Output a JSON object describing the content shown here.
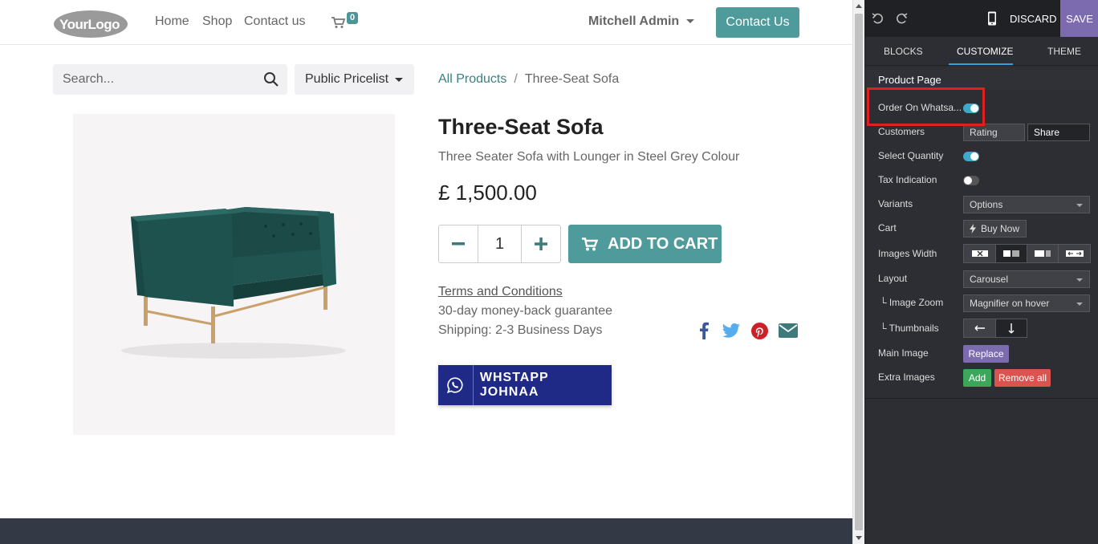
{
  "header": {
    "logo_text": "YourLogo",
    "nav": [
      "Home",
      "Shop",
      "Contact us"
    ],
    "cart_count": "0",
    "user": "Mitchell Admin",
    "contact_button": "Contact Us"
  },
  "shop": {
    "search_placeholder": "Search...",
    "pricelist": "Public Pricelist",
    "breadcrumb": {
      "root": "All Products",
      "current": "Three-Seat Sofa"
    }
  },
  "product": {
    "title": "Three-Seat Sofa",
    "description": "Three Seater Sofa with Lounger in Steel Grey Colour",
    "price": "£ 1,500.00",
    "quantity": "1",
    "add_to_cart": "ADD TO CART",
    "terms": "Terms and Conditions",
    "guarantee": "30-day money-back guarantee",
    "shipping": "Shipping: 2-3 Business Days",
    "whatsapp_label": "WHSTAPP JOHNAA"
  },
  "editor": {
    "discard": "DISCARD",
    "save": "SAVE",
    "tabs": [
      "BLOCKS",
      "CUSTOMIZE",
      "THEME"
    ],
    "active_tab": "CUSTOMIZE",
    "section": "Product Page",
    "options": {
      "order_on_whatsapp": {
        "label": "Order On Whatsa...",
        "on": true
      },
      "customers": {
        "label": "Customers",
        "rating": "Rating",
        "share": "Share"
      },
      "select_quantity": {
        "label": "Select Quantity",
        "on": true
      },
      "tax_indication": {
        "label": "Tax Indication",
        "on": false
      },
      "variants": {
        "label": "Variants",
        "value": "Options"
      },
      "cart": {
        "label": "Cart",
        "value": "Buy Now"
      },
      "images_width": {
        "label": "Images Width"
      },
      "layout": {
        "label": "Layout",
        "value": "Carousel"
      },
      "image_zoom": {
        "label": "└ Image Zoom",
        "value": "Magnifier on hover"
      },
      "thumbnails": {
        "label": "└ Thumbnails"
      },
      "main_image": {
        "label": "Main Image",
        "button": "Replace"
      },
      "extra_images": {
        "label": "Extra Images",
        "add": "Add",
        "remove": "Remove all"
      }
    }
  },
  "colors": {
    "accent": "#4f9a9b",
    "whatsapp_button": "#1f2a87",
    "panel_bg": "#2c2e33",
    "save_bg": "#7d6bb0",
    "highlight": "#e02020"
  },
  "icons": [
    "cart-icon",
    "search-icon",
    "minus-icon",
    "plus-icon",
    "facebook-icon",
    "twitter-icon",
    "pinterest-icon",
    "envelope-icon",
    "whatsapp-icon",
    "undo-icon",
    "redo-icon",
    "mobile-icon"
  ]
}
